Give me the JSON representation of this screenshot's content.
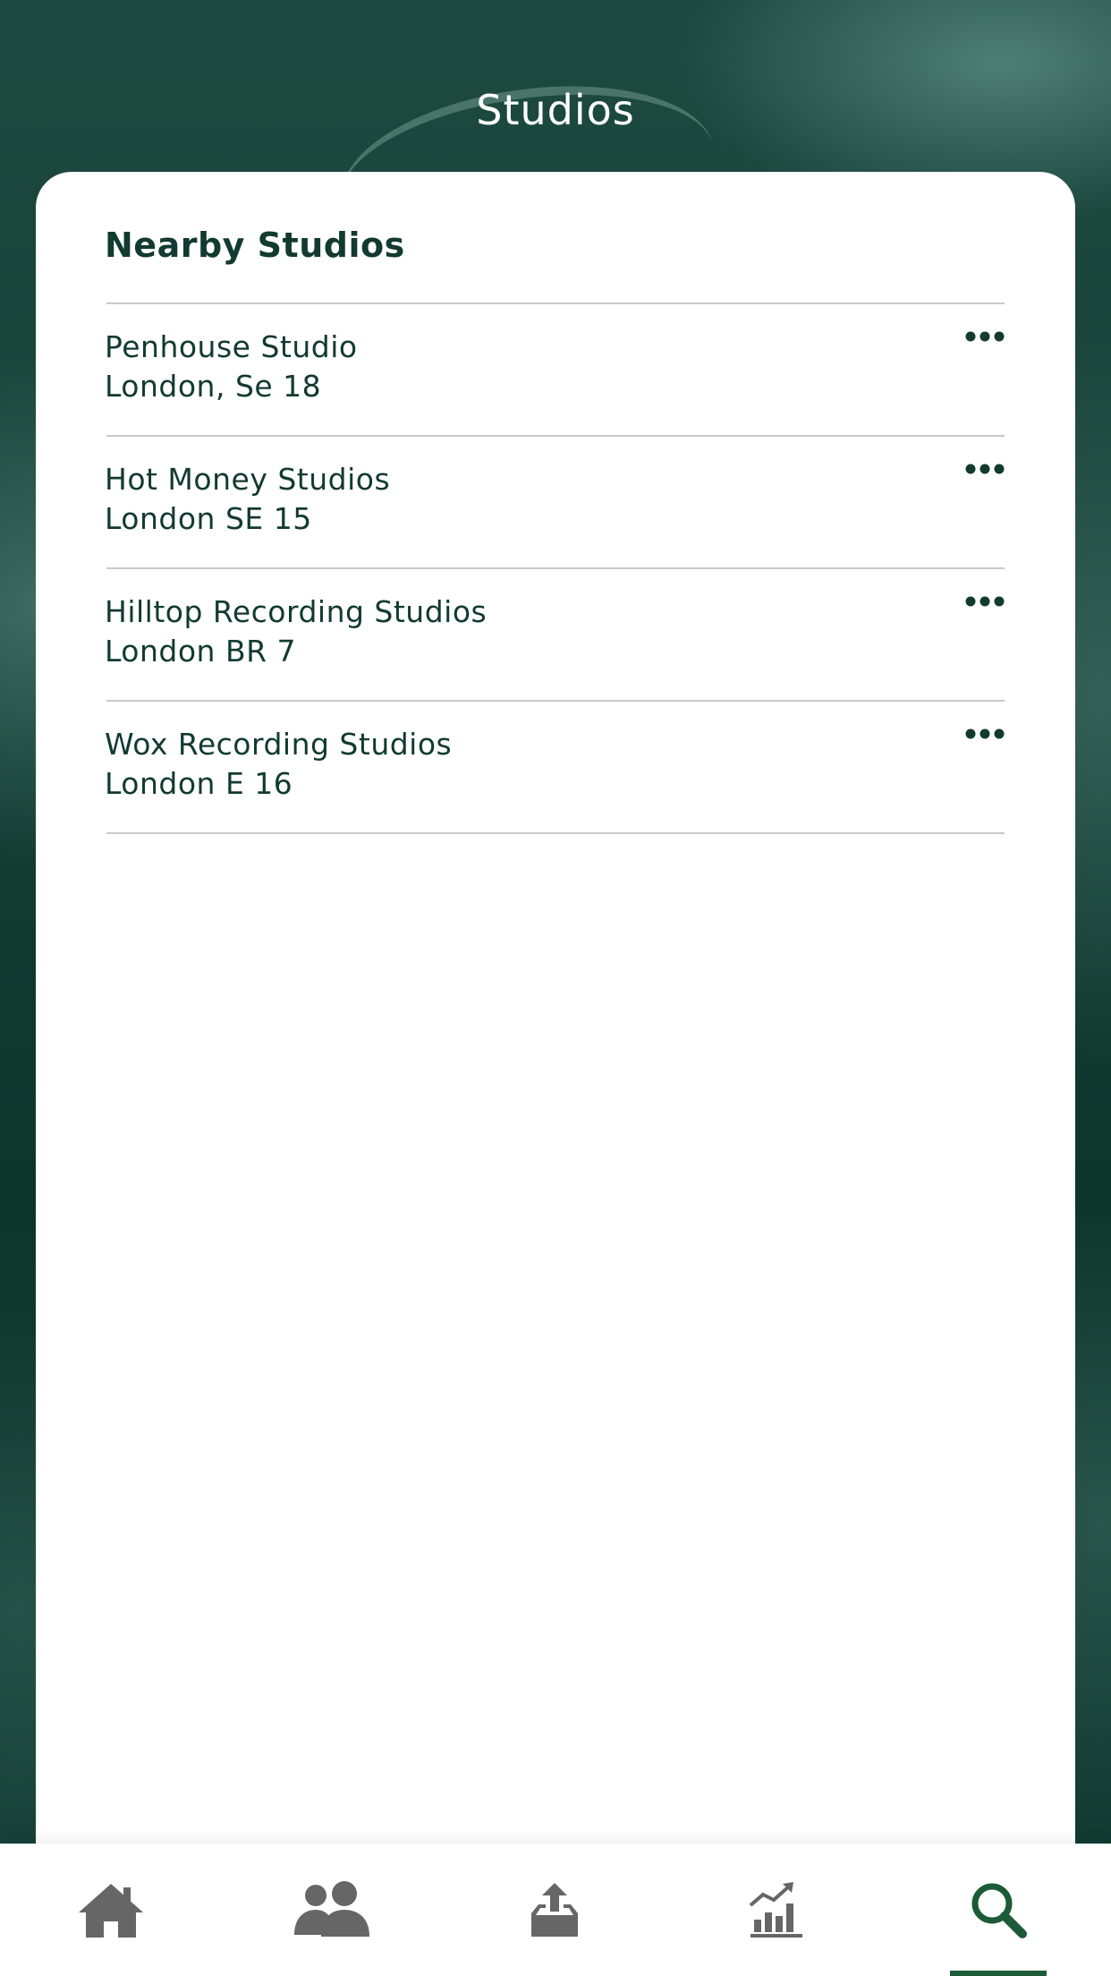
{
  "header": {
    "title": "Studios"
  },
  "section": {
    "title": "Nearby Studios"
  },
  "studios": [
    {
      "name": "Penhouse Studio",
      "location": "London, Se 18"
    },
    {
      "name": "Hot Money Studios",
      "location": "London SE 15"
    },
    {
      "name": "Hilltop Recording Studios",
      "location": "London BR 7"
    },
    {
      "name": "Wox Recording Studios",
      "location": "London E 16"
    }
  ],
  "tabbar": {
    "items": [
      {
        "icon": "home-icon",
        "active": false
      },
      {
        "icon": "users-icon",
        "active": false
      },
      {
        "icon": "upload-icon",
        "active": false
      },
      {
        "icon": "stats-icon",
        "active": false
      },
      {
        "icon": "search-icon",
        "active": true
      }
    ]
  },
  "colors": {
    "accent": "#1d5a36",
    "text": "#123a30",
    "inactive_icon": "#666666"
  }
}
